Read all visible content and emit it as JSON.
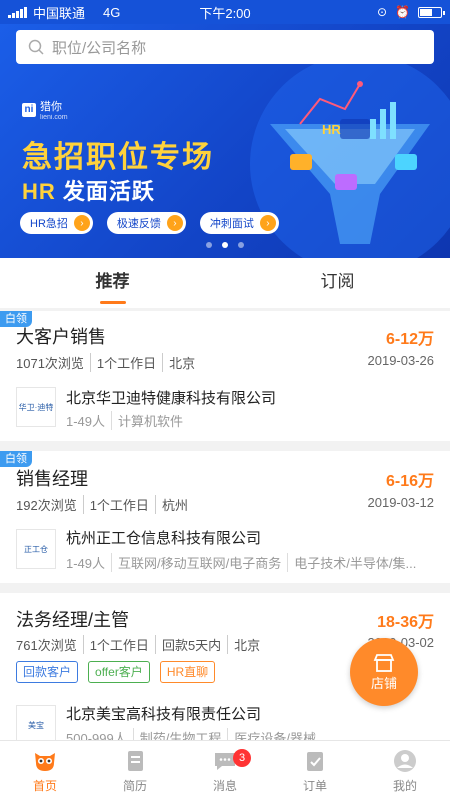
{
  "status_bar": {
    "carrier": "中国联通",
    "network": "4G",
    "time": "下午2:00"
  },
  "search": {
    "placeholder": "职位/公司名称"
  },
  "banner": {
    "logo_text": "猎你",
    "logo_sub": "lieni.com",
    "title": "急招职位专场",
    "sub_hr": "HR",
    "sub_rest": " 发面活跃",
    "pills": [
      "HR急招",
      "极速反馈",
      "冲刺面试"
    ],
    "hr_badge": "HR",
    "active_dot": 1
  },
  "tabs": [
    {
      "label": "推荐"
    },
    {
      "label": "订阅"
    }
  ],
  "jobs": [
    {
      "tag": "白领",
      "title": "大客户销售",
      "salary": "6-12万",
      "meta": [
        "1071次浏览",
        "1个工作日",
        "北京"
      ],
      "date": "2019-03-26",
      "company": "北京华卫迪特健康科技有限公司",
      "company_info": [
        "1-49人",
        "计算机软件"
      ],
      "logo_text": "华卫·迪特"
    },
    {
      "tag": "白领",
      "title": "销售经理",
      "salary": "6-16万",
      "meta": [
        "192次浏览",
        "1个工作日",
        "杭州"
      ],
      "date": "2019-03-12",
      "company": "杭州正工仓信息科技有限公司",
      "company_info": [
        "1-49人",
        "互联网/移动互联网/电子商务",
        "电子技术/半导体/集..."
      ],
      "logo_text": "正工仓"
    },
    {
      "tag": "",
      "title": "法务经理/主管",
      "salary": "18-36万",
      "meta": [
        "761次浏览",
        "1个工作日",
        "回款5天内",
        "北京"
      ],
      "date": "2019-03-02",
      "badges": [
        {
          "label": "回款客户",
          "color": "#3d7be0"
        },
        {
          "label": "offer客户",
          "color": "#4caf50"
        },
        {
          "label": "HR直聊",
          "color": "#ff8a2a"
        }
      ],
      "company": "北京美宝高科技有限责任公司",
      "company_info": [
        "500-999人",
        "制药/生物工程",
        "医疗设备/器械"
      ],
      "logo_text": "美宝"
    }
  ],
  "fab": {
    "label": "店铺"
  },
  "nav": [
    {
      "label": "首页",
      "icon": "owl-home-icon",
      "active": true
    },
    {
      "label": "简历",
      "icon": "resume-icon"
    },
    {
      "label": "消息",
      "icon": "chat-icon",
      "badge": "3"
    },
    {
      "label": "订单",
      "icon": "order-icon"
    },
    {
      "label": "我的",
      "icon": "profile-icon"
    }
  ],
  "colors": {
    "accent": "#ff7a1a",
    "banner_blue": "#1552d8",
    "tag_blue": "#3d9bf0"
  }
}
